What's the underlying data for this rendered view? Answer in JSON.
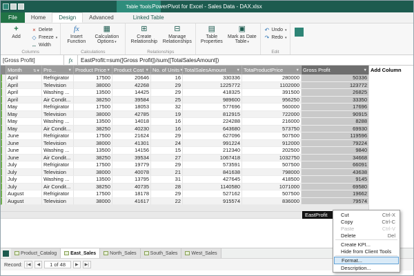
{
  "window": {
    "title": "PowerPivot for Excel - Sales Data - DAX.xlsx",
    "context_band": "Table Tools"
  },
  "tabs": {
    "file": "File",
    "home": "Home",
    "design": "Design",
    "advanced": "Advanced",
    "contextual": "Linked Table"
  },
  "ribbon": {
    "columns": {
      "label": "Columns",
      "add": "Add",
      "delete": "Delete",
      "freeze": "Freeze",
      "width": "Width"
    },
    "calculations": {
      "label": "Calculations",
      "insert_function": "Insert Function",
      "calc_options": "Calculation Options"
    },
    "relationships": {
      "label": "Relationships",
      "create": "Create Relationship",
      "manage": "Manage Relationships"
    },
    "table_tools": {
      "properties": "Table Properties",
      "mark_date": "Mark as Date Table"
    },
    "edit": {
      "label": "Edit",
      "undo": "Undo",
      "redo": "Redo"
    }
  },
  "formula_bar": {
    "name_box": "[Gross Profit]",
    "fx": "fx",
    "formula": "EastProfit:=sum([Gross Profit])/sum([TotalSalesAmount])"
  },
  "table": {
    "columns": [
      "Month",
      "Pro...",
      "Product Price",
      "Product Cost",
      "No. of Units",
      "TotalSalesAmount",
      "TotaProductPrice",
      "Gross Profit",
      "Add Column"
    ],
    "sort_icon": "⇅",
    "filter_icon": "▼",
    "measure_cell": "EastProfit",
    "rows": [
      {
        "month": "April",
        "product": "Refrigirator",
        "price": "17500",
        "cost": "20646",
        "units": "16",
        "sales": "330336",
        "total": "280000",
        "gross": "50336"
      },
      {
        "month": "April",
        "product": "Television",
        "price": "38000",
        "cost": "42268",
        "units": "29",
        "sales": "1225772",
        "total": "1102000",
        "gross": "123772"
      },
      {
        "month": "April",
        "product": "Washing ...",
        "price": "13500",
        "cost": "14425",
        "units": "29",
        "sales": "418325",
        "total": "391500",
        "gross": "26825"
      },
      {
        "month": "April",
        "product": "Air Condit...",
        "price": "38250",
        "cost": "39584",
        "units": "25",
        "sales": "989600",
        "total": "956250",
        "gross": "33350"
      },
      {
        "month": "May",
        "product": "Refrigirator",
        "price": "17500",
        "cost": "18053",
        "units": "32",
        "sales": "577696",
        "total": "560000",
        "gross": "17696"
      },
      {
        "month": "May",
        "product": "Television",
        "price": "38000",
        "cost": "42785",
        "units": "19",
        "sales": "812915",
        "total": "722000",
        "gross": "90915"
      },
      {
        "month": "May",
        "product": "Washing ...",
        "price": "13500",
        "cost": "14018",
        "units": "16",
        "sales": "224288",
        "total": "216000",
        "gross": "8288"
      },
      {
        "month": "May",
        "product": "Air Condit...",
        "price": "38250",
        "cost": "40230",
        "units": "16",
        "sales": "643680",
        "total": "573750",
        "gross": "69930"
      },
      {
        "month": "June",
        "product": "Refrigirator",
        "price": "17500",
        "cost": "21624",
        "units": "29",
        "sales": "627096",
        "total": "507500",
        "gross": "119596"
      },
      {
        "month": "June",
        "product": "Television",
        "price": "38000",
        "cost": "41301",
        "units": "24",
        "sales": "991224",
        "total": "912000",
        "gross": "79224"
      },
      {
        "month": "June",
        "product": "Washing ...",
        "price": "13500",
        "cost": "14156",
        "units": "15",
        "sales": "212340",
        "total": "202500",
        "gross": "9840"
      },
      {
        "month": "June",
        "product": "Air Condit...",
        "price": "38250",
        "cost": "39534",
        "units": "27",
        "sales": "1067418",
        "total": "1032750",
        "gross": "34668"
      },
      {
        "month": "July",
        "product": "Refrigirator",
        "price": "17500",
        "cost": "19779",
        "units": "29",
        "sales": "573591",
        "total": "507500",
        "gross": "66091"
      },
      {
        "month": "July",
        "product": "Television",
        "price": "38000",
        "cost": "40078",
        "units": "21",
        "sales": "841638",
        "total": "798000",
        "gross": "43638"
      },
      {
        "month": "July",
        "product": "Washing ...",
        "price": "13500",
        "cost": "13795",
        "units": "31",
        "sales": "427645",
        "total": "418500",
        "gross": "9145"
      },
      {
        "month": "July",
        "product": "Air Condit...",
        "price": "38250",
        "cost": "40735",
        "units": "28",
        "sales": "1140580",
        "total": "1071000",
        "gross": "69580"
      },
      {
        "month": "August",
        "product": "Refrigirator",
        "price": "17500",
        "cost": "18178",
        "units": "29",
        "sales": "527162",
        "total": "507500",
        "gross": "19662"
      },
      {
        "month": "August",
        "product": "Television",
        "price": "38000",
        "cost": "41617",
        "units": "22",
        "sales": "915574",
        "total": "836000",
        "gross": "79574"
      }
    ]
  },
  "context_menu": {
    "items": [
      {
        "label": "Cut",
        "shortcut": "Ctrl-X"
      },
      {
        "label": "Copy",
        "shortcut": "Ctrl-C"
      },
      {
        "label": "Paste",
        "shortcut": "Ctrl-V",
        "disabled": true
      },
      {
        "label": "Delete",
        "shortcut": "Del"
      },
      {
        "label": "Create KPI...",
        "sep_before": true
      },
      {
        "label": "Hide from Client Tools"
      },
      {
        "label": "Format...",
        "sep_before": true,
        "highlighted": true
      },
      {
        "label": "Description..."
      }
    ]
  },
  "sheet_tabs": {
    "tabs": [
      {
        "label": "Product_Catalog"
      },
      {
        "label": "East_Sales",
        "active": true
      },
      {
        "label": "North_Sales"
      },
      {
        "label": "South_Sales"
      },
      {
        "label": "West_Sales"
      }
    ]
  },
  "status_bar": {
    "record_label": "Record:",
    "position": "1 of 48",
    "nav_first": "|◀",
    "nav_prev": "◀",
    "nav_next": "▶",
    "nav_last": "▶|"
  },
  "colors": {
    "titlebar_teal": "#1d5b4f",
    "context_band_teal": "#2f8d7c",
    "file_green": "#217346",
    "header_gray": "#9b9b9b",
    "selected_column_gray": "#c9c9c9",
    "gutter_green": "#6fae4e"
  }
}
